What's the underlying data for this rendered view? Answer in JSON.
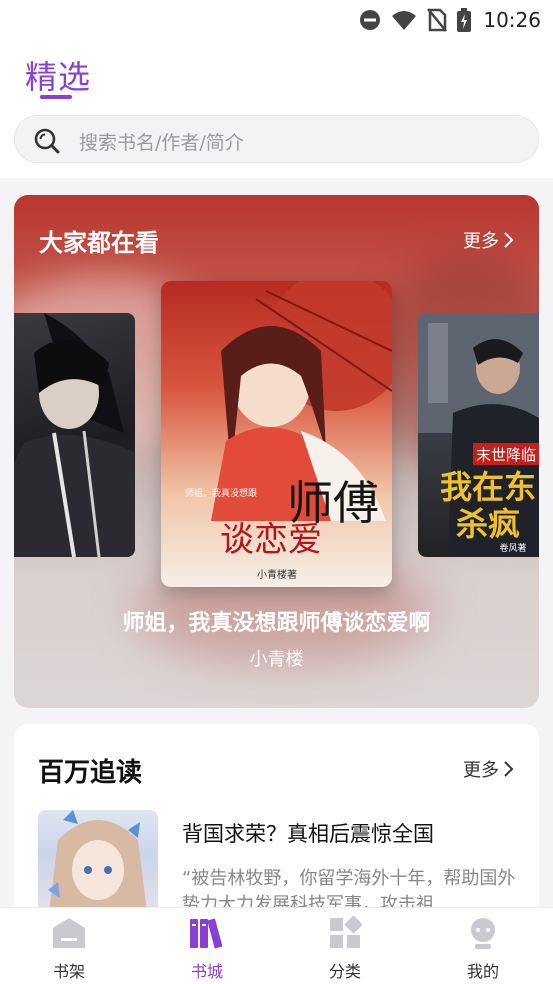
{
  "status_bar": {
    "time": "10:26"
  },
  "header": {
    "title": "精选"
  },
  "search": {
    "placeholder": "搜索书名/作者/简介"
  },
  "hot_section": {
    "title": "大家都在看",
    "more": "更多",
    "featured_book": {
      "title": "师姐，我真没想跟师傅谈恋爱啊",
      "author": "小青楼"
    },
    "featured_cover_text": {
      "big": "师傅",
      "big2": "谈恋爱",
      "small": "师姐，我真没想跟",
      "sign": "小青楼著"
    },
    "right_cover_text": {
      "top": "末世降临",
      "big": "我在东",
      "big2": "杀疯",
      "sign": "卷风著"
    }
  },
  "million_section": {
    "title": "百万追读",
    "more": "更多",
    "book": {
      "title": "背国求荣？真相后震惊全国",
      "desc": "“被告林牧野，你留学海外十年，帮助国外势力大力发展科技军事，攻击祖..."
    }
  },
  "bottom_nav": {
    "items": [
      {
        "label": "书架",
        "icon": "bookshelf-icon"
      },
      {
        "label": "书城",
        "icon": "bookstore-icon"
      },
      {
        "label": "分类",
        "icon": "category-icon"
      },
      {
        "label": "我的",
        "icon": "profile-icon"
      }
    ],
    "active": 1
  },
  "colors": {
    "accent": "#8a3fd6",
    "nav_inactive": "#c9c9cf"
  }
}
